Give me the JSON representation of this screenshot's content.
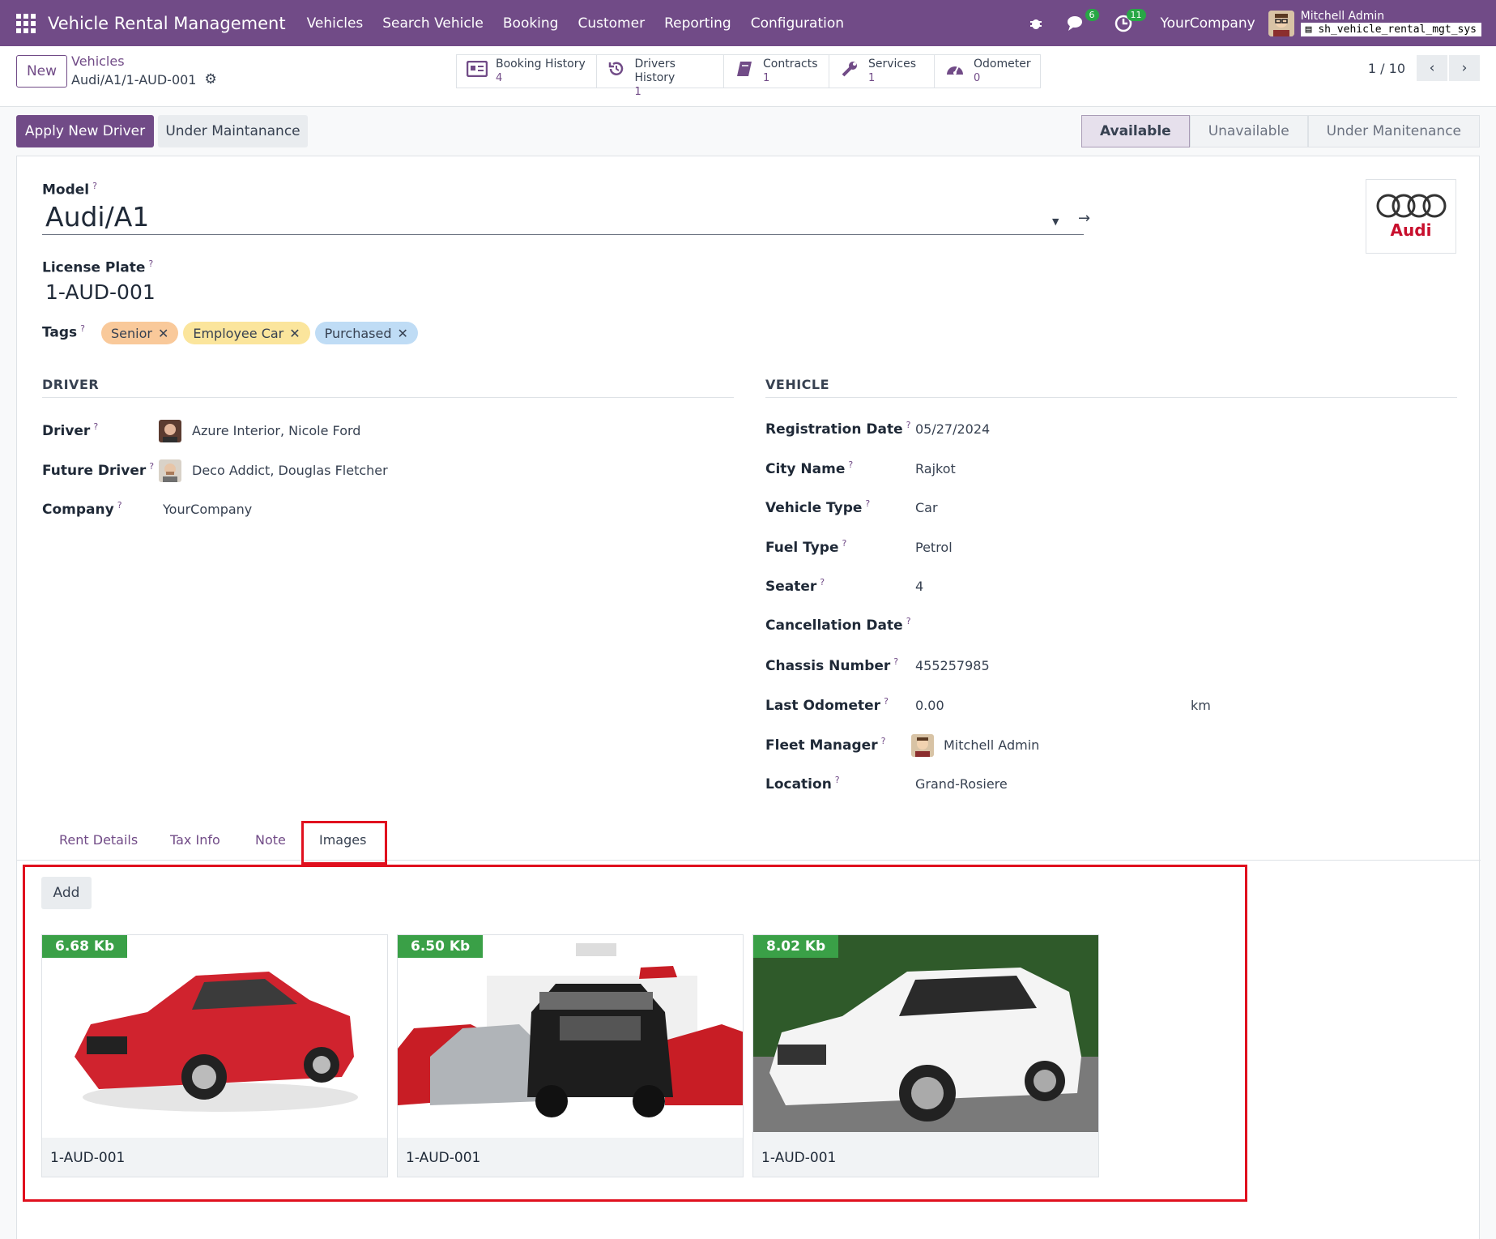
{
  "navbar": {
    "app_title": "Vehicle Rental Management",
    "menu": [
      "Vehicles",
      "Search Vehicle",
      "Booking",
      "Customer",
      "Reporting",
      "Configuration"
    ],
    "messages_count": "6",
    "activities_count": "11",
    "company": "YourCompany",
    "user_name": "Mitchell Admin",
    "database": "sh_vehicle_rental_mgt_sys",
    "color": "#714b87"
  },
  "control_panel": {
    "new_label": "New",
    "breadcrumb_parent": "Vehicles",
    "breadcrumb_current": "Audi/A1/1-AUD-001",
    "smart_buttons": [
      {
        "label": "Booking History",
        "value": "4",
        "icon": "id-card-icon"
      },
      {
        "label": "Drivers History",
        "value": "1",
        "icon": "history-icon"
      },
      {
        "label": "Contracts",
        "value": "1",
        "icon": "book-icon"
      },
      {
        "label": "Services",
        "value": "1",
        "icon": "wrench-icon"
      },
      {
        "label": "Odometer",
        "value": "0",
        "icon": "tachometer-icon"
      }
    ],
    "pager": "1 / 10"
  },
  "status_bar": {
    "apply_driver": "Apply New Driver",
    "under_maintanance": "Under Maintanance",
    "stages": [
      "Available",
      "Unavailable",
      "Under Manitenance"
    ],
    "active_stage": "Available"
  },
  "form": {
    "model_label": "Model",
    "model_value": "Audi/A1",
    "logo_text": "Audi",
    "license_plate_label": "License Plate",
    "license_plate_value": "1-AUD-001",
    "tags_label": "Tags",
    "tags": [
      {
        "name": "Senior",
        "color": "#f9c99a"
      },
      {
        "name": "Employee Car",
        "color": "#fbe59c"
      },
      {
        "name": "Purchased",
        "color": "#bfdcf5"
      }
    ],
    "driver_section": "DRIVER",
    "driver_label": "Driver",
    "driver_value": "Azure Interior, Nicole Ford",
    "future_driver_label": "Future Driver",
    "future_driver_value": "Deco Addict, Douglas Fletcher",
    "company_label": "Company",
    "company_value": "YourCompany",
    "vehicle_section": "VEHICLE",
    "registration_date_label": "Registration Date",
    "registration_date_value": "05/27/2024",
    "city_label": "City Name",
    "city_value": "Rajkot",
    "vehicle_type_label": "Vehicle Type",
    "vehicle_type_value": "Car",
    "fuel_type_label": "Fuel Type",
    "fuel_type_value": "Petrol",
    "seater_label": "Seater",
    "seater_value": "4",
    "cancellation_label": "Cancellation Date",
    "cancellation_value": "",
    "chassis_label": "Chassis Number",
    "chassis_value": "455257985",
    "odometer_label": "Last Odometer",
    "odometer_value": "0.00",
    "odometer_unit": "km",
    "fleet_manager_label": "Fleet Manager",
    "fleet_manager_value": "Mitchell Admin",
    "location_label": "Location",
    "location_value": "Grand-Rosiere"
  },
  "tabs": [
    "Rent Details",
    "Tax Info",
    "Note",
    "Images"
  ],
  "active_tab": "Images",
  "images": {
    "add_label": "Add",
    "items": [
      {
        "size": "6.68 Kb",
        "caption": "1-AUD-001",
        "desc": "red sedan"
      },
      {
        "size": "6.50 Kb",
        "caption": "1-AUD-001",
        "desc": "car lineup"
      },
      {
        "size": "8.02 Kb",
        "caption": "1-AUD-001",
        "desc": "white SUV"
      }
    ]
  }
}
